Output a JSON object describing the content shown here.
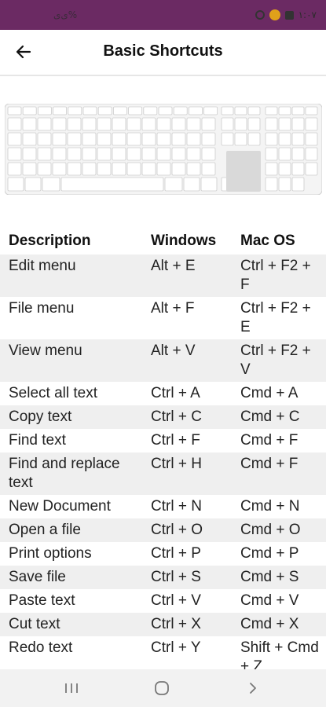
{
  "status_bar": {
    "left_text": "ﻯﻯ%",
    "right_text": "١:٠٧"
  },
  "app_bar": {
    "title": "Basic Shortcuts",
    "back_icon": "arrow-left-icon"
  },
  "table": {
    "headers": [
      "Description",
      "Windows",
      "Mac OS"
    ],
    "rows": [
      {
        "desc": "Edit menu",
        "win": "Alt + E",
        "mac": "Ctrl + F2 + F"
      },
      {
        "desc": "File menu",
        "win": "Alt + F",
        "mac": "Ctrl + F2 + E"
      },
      {
        "desc": "View menu",
        "win": "Alt + V",
        "mac": "Ctrl + F2 + V"
      },
      {
        "desc": "Select all text",
        "win": "Ctrl + A",
        "mac": "Cmd + A"
      },
      {
        "desc": "Copy text",
        "win": "Ctrl + C",
        "mac": "Cmd + C"
      },
      {
        "desc": "Find text",
        "win": "Ctrl + F",
        "mac": "Cmd + F"
      },
      {
        "desc": "Find and replace text",
        "win": "Ctrl + H",
        "mac": "Cmd + F"
      },
      {
        "desc": "New Document",
        "win": "Ctrl + N",
        "mac": "Cmd + N"
      },
      {
        "desc": "Open a file",
        "win": "Ctrl + O",
        "mac": "Cmd + O"
      },
      {
        "desc": "Print options",
        "win": "Ctrl + P",
        "mac": "Cmd + P"
      },
      {
        "desc": "Save file",
        "win": "Ctrl + S",
        "mac": "Cmd + S"
      },
      {
        "desc": "Paste text",
        "win": "Ctrl + V",
        "mac": "Cmd + V"
      },
      {
        "desc": "Cut text",
        "win": "Ctrl + X",
        "mac": "Cmd + X"
      },
      {
        "desc": "Redo text",
        "win": "Ctrl + Y",
        "mac": "Shift + Cmd + Z"
      }
    ]
  },
  "nav_bar": {
    "recent_icon": "recent-apps-icon",
    "home_icon": "home-icon",
    "back_icon": "chevron-right-icon"
  },
  "colors": {
    "status_bar": "#6b2a63",
    "row_alt": "#efefef",
    "nav_bar": "#f2f2f2"
  }
}
